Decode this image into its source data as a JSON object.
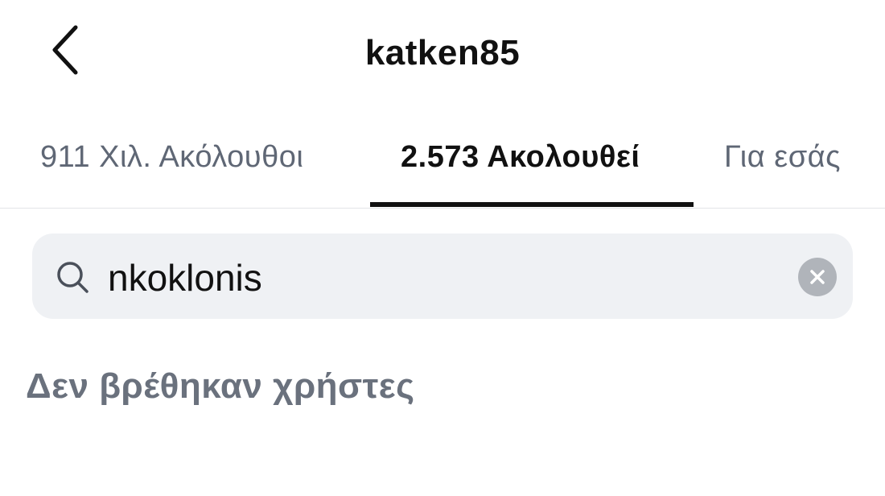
{
  "header": {
    "title": "katken85",
    "back_icon": "chevron-left-icon"
  },
  "tabs": [
    {
      "label": "911 Χιλ. Ακόλουθοι",
      "active": false
    },
    {
      "label": "2.573 Ακολουθεί",
      "active": true
    },
    {
      "label": "Για εσάς",
      "active": false
    }
  ],
  "search": {
    "value": "nkoklonis",
    "icon": "search-icon",
    "clear_icon": "clear-circle-icon"
  },
  "results": {
    "empty_message": "Δεν βρέθηκαν χρήστες"
  },
  "colors": {
    "text_primary": "#111111",
    "text_secondary": "#5f6775",
    "search_background": "#eff1f4",
    "clear_button": "#b0b4ba"
  }
}
